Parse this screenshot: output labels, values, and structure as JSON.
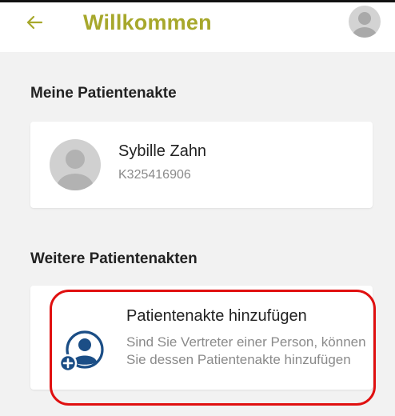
{
  "header": {
    "title": "Willkommen",
    "back_icon": "arrow-left-icon",
    "avatar_icon": "user-avatar-icon"
  },
  "my_record": {
    "section_title": "Meine Patientenakte",
    "patient": {
      "name": "Sybille Zahn",
      "id": "K325416906"
    }
  },
  "other_records": {
    "section_title": "Weitere Patientenakten",
    "add_card": {
      "icon": "add-person-icon",
      "title": "Patientenakte hinzufügen",
      "description": "Sind Sie Vertreter einer Person, können Sie dessen Patientenakte hinzufügen"
    }
  },
  "colors": {
    "accent": "#a7a82c",
    "icon_blue": "#1b4e86",
    "highlight": "#e01010",
    "background": "#f2f2f2"
  }
}
